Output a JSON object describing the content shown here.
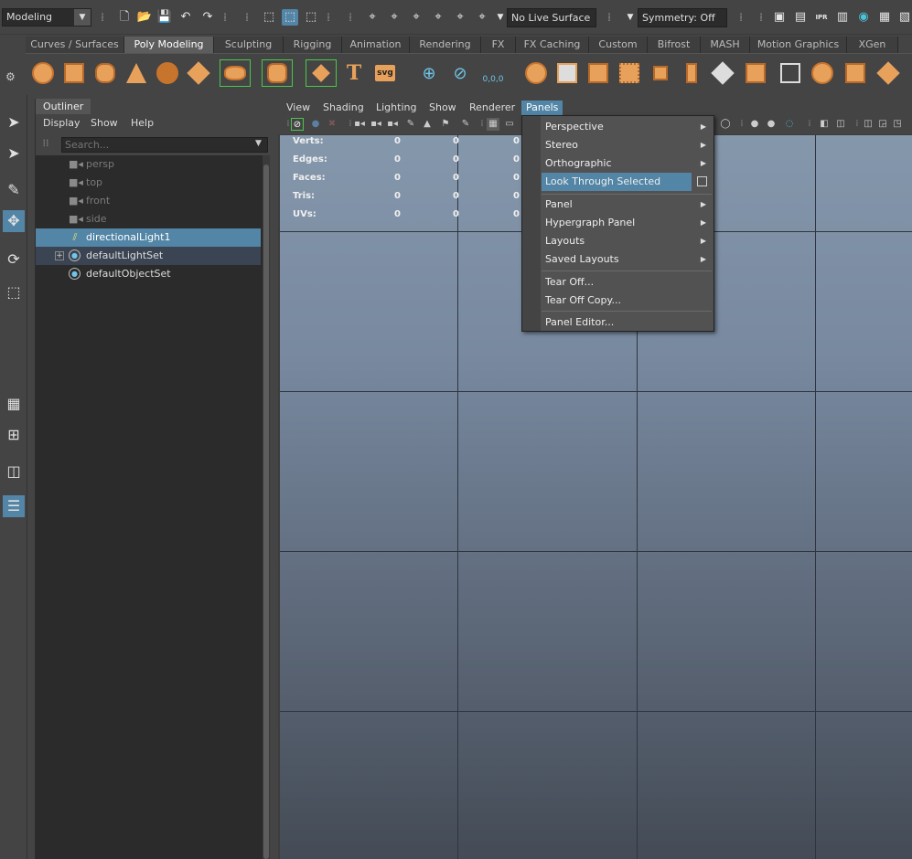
{
  "statusline": {
    "mode": "Modeling",
    "live_surface": "No Live Surface",
    "symmetry": "Symmetry: Off",
    "ipr_label": "IPR"
  },
  "shelf": {
    "tabs": [
      "Curves / Surfaces",
      "Poly Modeling",
      "Sculpting",
      "Rigging",
      "Animation",
      "Rendering",
      "FX",
      "FX Caching",
      "Custom",
      "Bifrost",
      "MASH",
      "Motion Graphics",
      "XGen"
    ],
    "active_tab": "Poly Modeling",
    "text_tool": "T",
    "svg_tool": "svg",
    "center_label": "0,0,0"
  },
  "outliner": {
    "title": "Outliner",
    "menu": [
      "Display",
      "Show",
      "Help"
    ],
    "search_placeholder": "Search...",
    "items": [
      {
        "label": "persp",
        "icon": "camera-icon",
        "state": "dim"
      },
      {
        "label": "top",
        "icon": "camera-icon",
        "state": "dim"
      },
      {
        "label": "front",
        "icon": "camera-icon",
        "state": "dim"
      },
      {
        "label": "side",
        "icon": "camera-icon",
        "state": "dim"
      },
      {
        "label": "directionalLight1",
        "icon": "directional-light-icon",
        "state": "selected"
      },
      {
        "label": "defaultLightSet",
        "icon": "set-icon",
        "state": "sub"
      },
      {
        "label": "defaultObjectSet",
        "icon": "set-icon",
        "state": "normal"
      }
    ]
  },
  "viewport": {
    "menu": [
      "View",
      "Shading",
      "Lighting",
      "Show",
      "Renderer",
      "Panels"
    ],
    "active_menu": "Panels",
    "hud": {
      "rows": [
        {
          "label": "Verts:",
          "v1": "0",
          "v2": "0",
          "v3": "0"
        },
        {
          "label": "Edges:",
          "v1": "0",
          "v2": "0",
          "v3": "0"
        },
        {
          "label": "Faces:",
          "v1": "0",
          "v2": "0",
          "v3": "0"
        },
        {
          "label": "Tris:",
          "v1": "0",
          "v2": "0",
          "v3": "0"
        },
        {
          "label": "UVs:",
          "v1": "0",
          "v2": "0",
          "v3": "0"
        }
      ]
    }
  },
  "panels_menu": {
    "items": [
      {
        "label": "Perspective",
        "submenu": true
      },
      {
        "label": "Stereo",
        "submenu": true
      },
      {
        "label": "Orthographic",
        "submenu": true
      },
      {
        "label": "Look Through Selected",
        "submenu": false,
        "highlighted": true,
        "option_box": true
      },
      {
        "label": "Panel",
        "submenu": true
      },
      {
        "label": "Hypergraph Panel",
        "submenu": true
      },
      {
        "label": "Layouts",
        "submenu": true
      },
      {
        "label": "Saved Layouts",
        "submenu": true
      },
      {
        "label": "Tear Off...",
        "submenu": false
      },
      {
        "label": "Tear Off Copy...",
        "submenu": false
      },
      {
        "label": "Panel Editor...",
        "submenu": false
      }
    ]
  },
  "colors": {
    "accent": "#5285a6",
    "shelf_icon": "#e7a15b",
    "panel_bg": "#444444",
    "field_bg": "#2b2b2b"
  }
}
